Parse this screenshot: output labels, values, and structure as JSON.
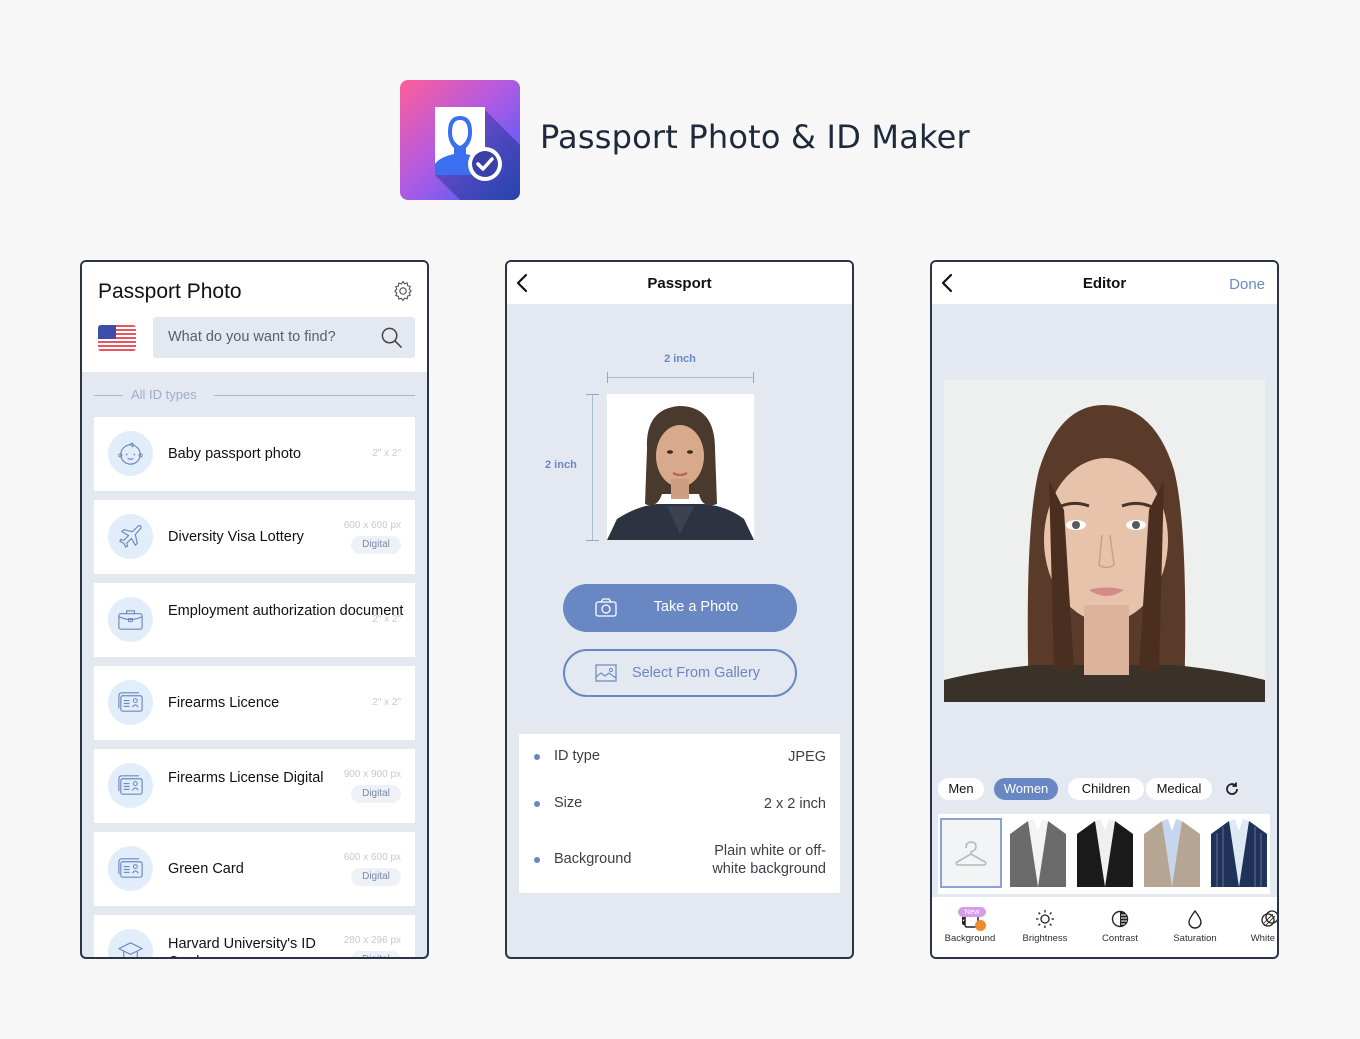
{
  "header": {
    "app_title": "Passport Photo & ID Maker",
    "app_icon": "passport-photo-app-icon",
    "colors": {
      "gradient_start": "#ff5c9a",
      "gradient_end": "#4b63f2"
    }
  },
  "screen_list": {
    "title": "Passport Photo",
    "settings_icon": "gear-icon",
    "country_flag": "us-flag",
    "search": {
      "placeholder": "What do you want to find?",
      "value": ""
    },
    "section_label": "All ID types",
    "items": [
      {
        "label": "Baby passport photo",
        "size": "2\" x 2\"",
        "badge": null,
        "icon": "baby-face-icon"
      },
      {
        "label": "Diversity Visa Lottery",
        "size": "600 x 600 px",
        "badge": "Digital",
        "icon": "airplane-icon"
      },
      {
        "label": "Employment authorization document",
        "size": "2\" x 2\"",
        "badge": null,
        "icon": "briefcase-icon"
      },
      {
        "label": "Firearms Licence",
        "size": "2\" x 2\"",
        "badge": null,
        "icon": "id-card-icon"
      },
      {
        "label": "Firearms License Digital",
        "size": "900 x 900 px",
        "badge": "Digital",
        "icon": "id-card-icon"
      },
      {
        "label": "Green Card",
        "size": "600 x 600 px",
        "badge": "Digital",
        "icon": "id-card-icon"
      },
      {
        "label": "Harvard University's ID Card",
        "size": "280 x 296 px",
        "badge": "Digital",
        "icon": "graduation-cap-icon"
      }
    ]
  },
  "screen_passport": {
    "title": "Passport",
    "width_label": "2 inch",
    "height_label": "2 inch",
    "take_photo_label": "Take a Photo",
    "gallery_label": "Select From Gallery",
    "info": [
      {
        "key": "ID type",
        "value": "JPEG"
      },
      {
        "key": "Size",
        "value": "2 x 2 inch"
      },
      {
        "key": "Background",
        "value": "Plain white or off-white background"
      }
    ],
    "accent_color": "#6987c2"
  },
  "screen_editor": {
    "title": "Editor",
    "done_label": "Done",
    "categories": [
      {
        "label": "Men",
        "active": false
      },
      {
        "label": "Women",
        "active": true
      },
      {
        "label": "Children",
        "active": false
      },
      {
        "label": "Medical",
        "active": false
      }
    ],
    "outfits": [
      {
        "name": "none",
        "selected": true
      },
      {
        "name": "grey-blazer",
        "selected": false
      },
      {
        "name": "black-blazer",
        "selected": false
      },
      {
        "name": "beige-blazer",
        "selected": false
      },
      {
        "name": "navy-pinstripe-blazer",
        "selected": false
      }
    ],
    "tools": [
      {
        "label": "Background",
        "new_badge": "New",
        "locked": true
      },
      {
        "label": "Brightness"
      },
      {
        "label": "Contrast"
      },
      {
        "label": "Saturation"
      },
      {
        "label": "White Ba"
      }
    ]
  }
}
